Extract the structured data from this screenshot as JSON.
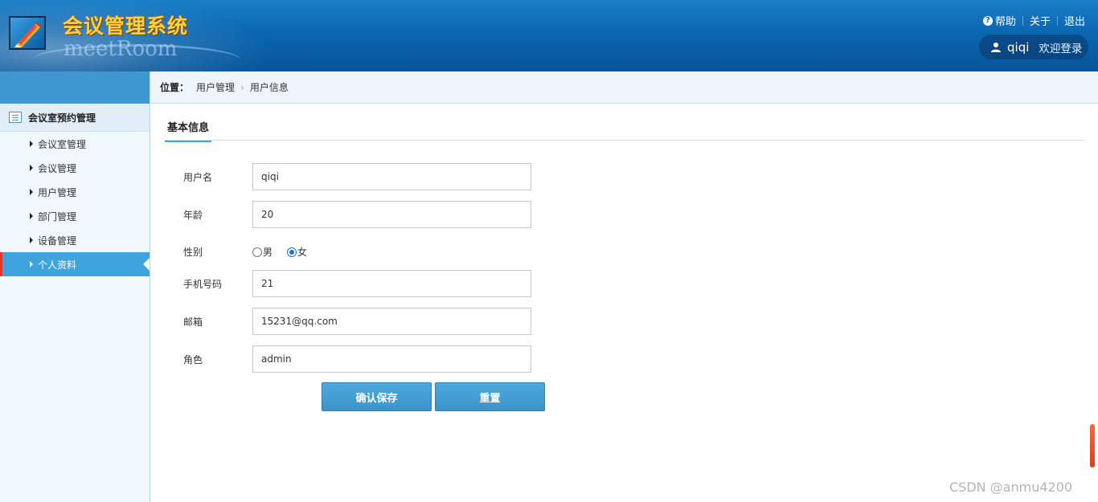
{
  "header": {
    "title": "会议管理系统",
    "subtitle": "meetRoom",
    "links": {
      "help": "帮助",
      "about": "关于",
      "logout": "退出"
    },
    "user": {
      "name": "qiqi",
      "welcome": "欢迎登录"
    }
  },
  "sidebar": {
    "group": "会议室预约管理",
    "items": [
      {
        "label": "会议室管理"
      },
      {
        "label": "会议管理"
      },
      {
        "label": "用户管理"
      },
      {
        "label": "部门管理"
      },
      {
        "label": "设备管理"
      },
      {
        "label": "个人资料"
      }
    ]
  },
  "breadcrumb": {
    "label": "位置：",
    "items": [
      "用户管理",
      "用户信息"
    ],
    "separator": "›"
  },
  "section": {
    "title": "基本信息"
  },
  "form": {
    "username": {
      "label": "用户名",
      "value": "qiqi"
    },
    "age": {
      "label": "年龄",
      "value": "20"
    },
    "gender": {
      "label": "性别",
      "options": [
        "男",
        "女"
      ],
      "selected": "女"
    },
    "phone": {
      "label": "手机号码",
      "value": "21"
    },
    "email": {
      "label": "邮箱",
      "value": "15231@qq.com"
    },
    "role": {
      "label": "角色",
      "value": "admin"
    },
    "save_label": "确认保存",
    "reset_label": "重置"
  },
  "watermark": "CSDN @anmu4200",
  "colors": {
    "header": "#0b66b0",
    "accent": "#3fa4dd",
    "active_marker": "#e03a2e",
    "title": "#ffd23a"
  }
}
